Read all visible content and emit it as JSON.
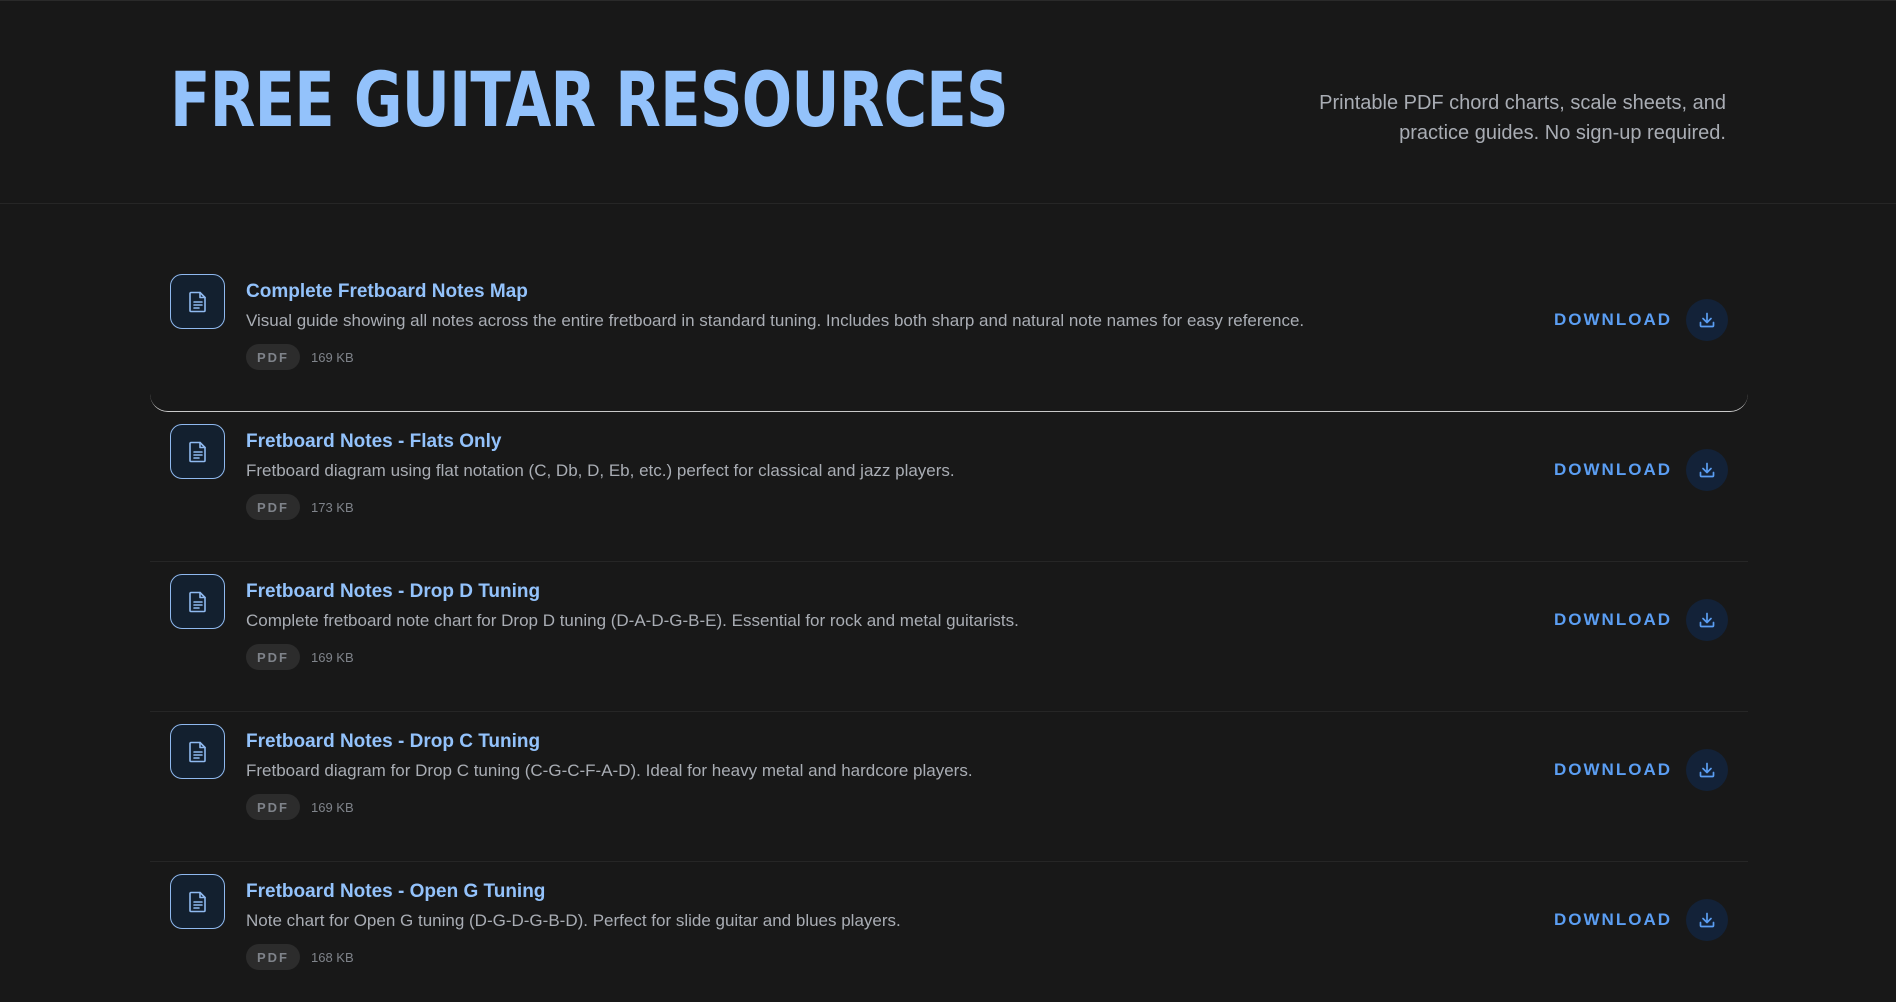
{
  "header": {
    "title": "FREE GUITAR RESOURCES",
    "subtitle": "Printable PDF chord charts, scale sheets, and practice guides. No sign-up required."
  },
  "colors": {
    "background": "#181818",
    "accent_title": "#93c2fb",
    "accent_download": "#5b9ef3",
    "muted_text": "#a9adb4"
  },
  "resources": [
    {
      "title": "Complete Fretboard Notes Map",
      "description": "Visual guide showing all notes across the entire fretboard in standard tuning. Includes both sharp and natural note names for easy reference.",
      "type": "PDF",
      "size": "169 KB",
      "action_label": "DOWNLOAD",
      "icon": "document-icon"
    },
    {
      "title": "Fretboard Notes - Flats Only",
      "description": "Fretboard diagram using flat notation (C, Db, D, Eb, etc.) perfect for classical and jazz players.",
      "type": "PDF",
      "size": "173 KB",
      "action_label": "DOWNLOAD",
      "icon": "document-icon"
    },
    {
      "title": "Fretboard Notes - Drop D Tuning",
      "description": "Complete fretboard note chart for Drop D tuning (D-A-D-G-B-E). Essential for rock and metal guitarists.",
      "type": "PDF",
      "size": "169 KB",
      "action_label": "DOWNLOAD",
      "icon": "document-icon"
    },
    {
      "title": "Fretboard Notes - Drop C Tuning",
      "description": "Fretboard diagram for Drop C tuning (C-G-C-F-A-D). Ideal for heavy metal and hardcore players.",
      "type": "PDF",
      "size": "169 KB",
      "action_label": "DOWNLOAD",
      "icon": "document-icon"
    },
    {
      "title": "Fretboard Notes - Open G Tuning",
      "description": "Note chart for Open G tuning (D-G-D-G-B-D). Perfect for slide guitar and blues players.",
      "type": "PDF",
      "size": "168 KB",
      "action_label": "DOWNLOAD",
      "icon": "document-icon"
    }
  ]
}
